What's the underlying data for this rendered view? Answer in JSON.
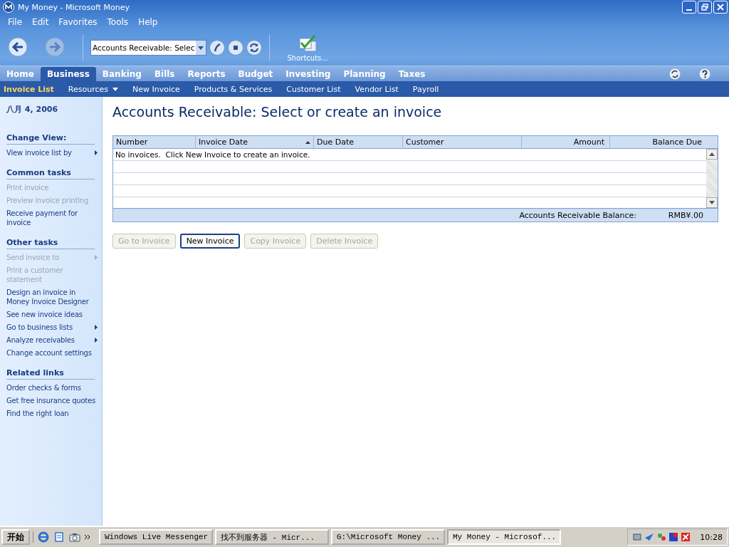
{
  "window": {
    "title": "My Money - Microsoft Money"
  },
  "menu": [
    "File",
    "Edit",
    "Favorites",
    "Tools",
    "Help"
  ],
  "toolbar": {
    "address": "Accounts Receivable: Selec",
    "shortcuts_label": "Shortcuts..."
  },
  "tabs": [
    {
      "label": "Home",
      "selected": false
    },
    {
      "label": "Business",
      "selected": true
    },
    {
      "label": "Banking",
      "selected": false
    },
    {
      "label": "Bills",
      "selected": false
    },
    {
      "label": "Reports",
      "selected": false
    },
    {
      "label": "Budget",
      "selected": false
    },
    {
      "label": "Investing",
      "selected": false
    },
    {
      "label": "Planning",
      "selected": false
    },
    {
      "label": "Taxes",
      "selected": false
    }
  ],
  "subnav": [
    {
      "label": "Invoice List",
      "selected": true,
      "kind": "link"
    },
    {
      "label": "Resources",
      "selected": false,
      "kind": "dropdown"
    },
    {
      "label": "New Invoice",
      "selected": false,
      "kind": "link"
    },
    {
      "label": "Products & Services",
      "selected": false,
      "kind": "link"
    },
    {
      "label": "Customer List",
      "selected": false,
      "kind": "link"
    },
    {
      "label": "Vendor List",
      "selected": false,
      "kind": "link"
    },
    {
      "label": "Payroll",
      "selected": false,
      "kind": "link"
    }
  ],
  "sidebar": {
    "date": "八月 4, 2006",
    "sections": [
      {
        "title": "Change View:",
        "items": [
          {
            "label": "View invoice list by",
            "disabled": false,
            "kind": "submenu"
          }
        ]
      },
      {
        "title": "Common tasks",
        "items": [
          {
            "label": "Print invoice",
            "disabled": true,
            "kind": "link"
          },
          {
            "label": "Preview invoice printing",
            "disabled": true,
            "kind": "link"
          },
          {
            "label": "Receive payment for invoice",
            "disabled": false,
            "kind": "link"
          }
        ]
      },
      {
        "title": "Other tasks",
        "items": [
          {
            "label": "Send invoice to",
            "disabled": true,
            "kind": "submenu"
          },
          {
            "label": "Print a customer statement",
            "disabled": true,
            "kind": "link"
          },
          {
            "label": "Design an invoice in Money Invoice Designer",
            "disabled": false,
            "kind": "link"
          },
          {
            "label": "See new invoice ideas",
            "disabled": false,
            "kind": "link"
          },
          {
            "label": "Go to business lists",
            "disabled": false,
            "kind": "submenu"
          },
          {
            "label": "Analyze receivables",
            "disabled": false,
            "kind": "submenu"
          },
          {
            "label": "Change account settings",
            "disabled": false,
            "kind": "link"
          }
        ]
      },
      {
        "title": "Related links",
        "items": [
          {
            "label": "Order checks & forms",
            "disabled": false,
            "kind": "link"
          },
          {
            "label": "Get free insurance quotes",
            "disabled": false,
            "kind": "link"
          },
          {
            "label": "Find the right loan",
            "disabled": false,
            "kind": "link"
          }
        ]
      }
    ]
  },
  "page": {
    "heading": "Accounts Receivable: Select or create an invoice"
  },
  "table": {
    "columns": [
      {
        "label": "Number",
        "sorted": false
      },
      {
        "label": "Invoice Date",
        "sorted": true
      },
      {
        "label": "Due Date",
        "sorted": false
      },
      {
        "label": "Customer",
        "sorted": false
      },
      {
        "label": "Amount",
        "sorted": false
      },
      {
        "label": "Balance Due",
        "sorted": false
      }
    ],
    "message": "No invoices.  Click New Invoice to create an invoice.",
    "footer": {
      "label": "Accounts Receivable Balance:",
      "value": "RMB¥.00"
    }
  },
  "buttons": [
    {
      "label": "Go to Invoice",
      "disabled": true,
      "focused": false
    },
    {
      "label": "New Invoice",
      "disabled": false,
      "focused": true
    },
    {
      "label": "Copy Invoice",
      "disabled": true,
      "focused": false
    },
    {
      "label": "Delete Invoice",
      "disabled": true,
      "focused": false
    }
  ],
  "taskbar": {
    "start": "开始",
    "tasks": [
      {
        "label": "Windows Live Messenger",
        "selected": false
      },
      {
        "label": "找不到服务器 - Micr...",
        "selected": false
      },
      {
        "label": "G:\\Microsoft Money ...",
        "selected": false
      },
      {
        "label": "My Money - Microsof...",
        "selected": true
      }
    ],
    "clock": "10:28"
  }
}
